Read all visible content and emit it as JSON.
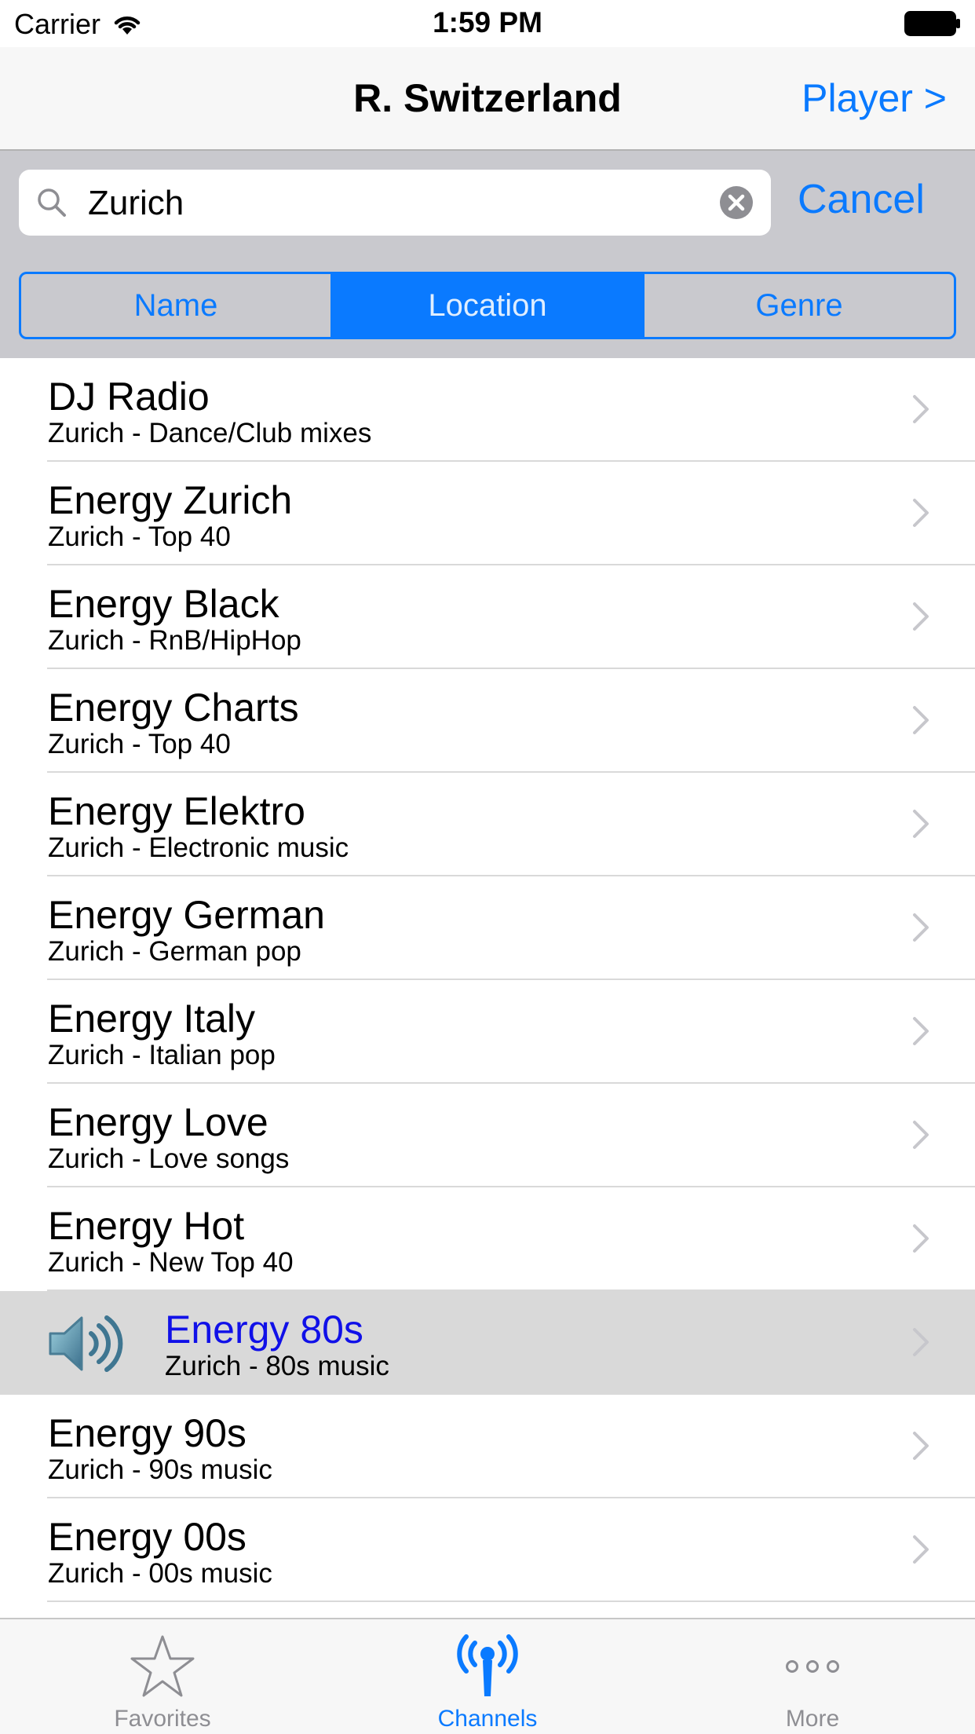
{
  "status_bar": {
    "carrier": "Carrier",
    "time": "1:59 PM"
  },
  "nav": {
    "title": "R. Switzerland",
    "right_button": "Player >"
  },
  "search": {
    "value": "Zurich",
    "cancel_label": "Cancel"
  },
  "scope": {
    "options": [
      {
        "label": "Name"
      },
      {
        "label": "Location"
      },
      {
        "label": "Genre"
      }
    ],
    "selected": "Location"
  },
  "list": {
    "rows": [
      {
        "title": "DJ Radio",
        "subtitle": "Zurich - Dance/Club mixes"
      },
      {
        "title": "Energy Zurich",
        "subtitle": "Zurich - Top 40"
      },
      {
        "title": "Energy Black",
        "subtitle": "Zurich - RnB/HipHop"
      },
      {
        "title": "Energy Charts",
        "subtitle": "Zurich - Top 40"
      },
      {
        "title": "Energy Elektro",
        "subtitle": "Zurich - Electronic music"
      },
      {
        "title": "Energy German",
        "subtitle": "Zurich - German pop"
      },
      {
        "title": "Energy Italy",
        "subtitle": "Zurich - Italian pop"
      },
      {
        "title": "Energy Love",
        "subtitle": "Zurich - Love songs"
      },
      {
        "title": "Energy Hot",
        "subtitle": "Zurich - New Top 40"
      },
      {
        "title": "Energy 80s",
        "subtitle": "Zurich - 80s music",
        "playing": true
      },
      {
        "title": "Energy 90s",
        "subtitle": "Zurich - 90s music"
      },
      {
        "title": "Energy 00s",
        "subtitle": "Zurich - 00s music"
      }
    ]
  },
  "tabs": {
    "items": [
      {
        "label": "Favorites",
        "icon": "star-icon"
      },
      {
        "label": "Channels",
        "icon": "antenna-icon",
        "active": true
      },
      {
        "label": "More",
        "icon": "more-icon"
      }
    ]
  },
  "colors": {
    "accent": "#0a7aff",
    "playing_title": "#1010e8",
    "selected_row": "#d9d9d9",
    "search_bg": "#c9c9ce"
  }
}
